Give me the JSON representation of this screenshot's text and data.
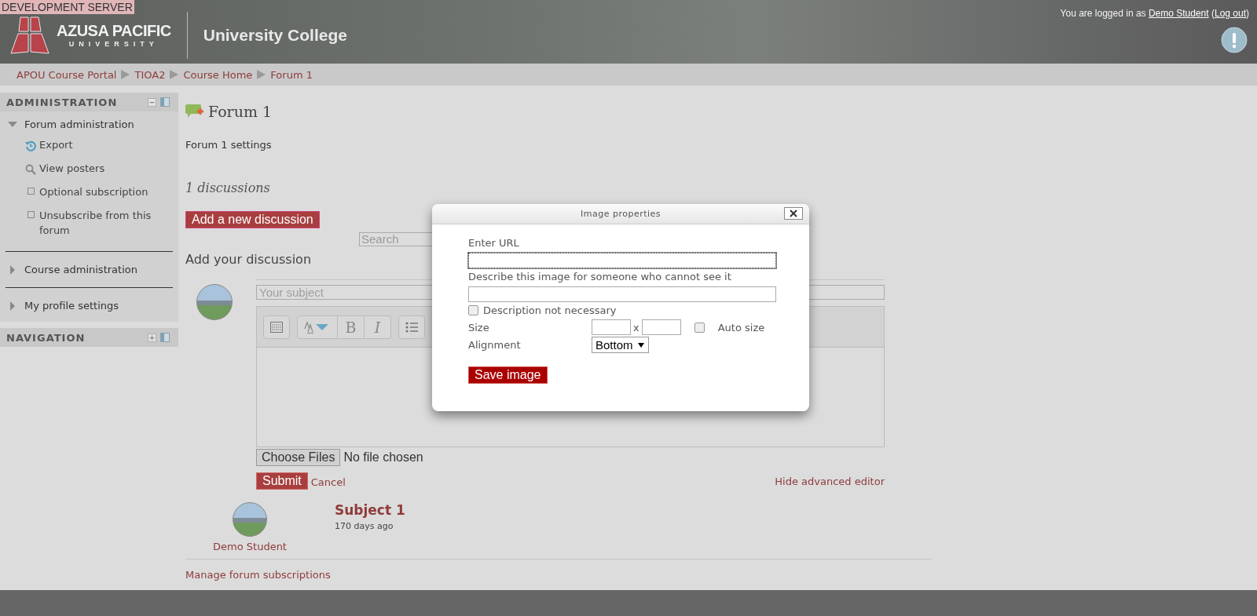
{
  "dev_banner": "DEVELOPMENT SERVER",
  "header": {
    "logo_name": "AZUSA PACIFIC",
    "logo_sub": "UNIVERSITY",
    "site_title": "University College",
    "login_text": "You are logged in as",
    "user": "Demo Student",
    "logout_before": "(",
    "logout": "Log out",
    "logout_after": ")"
  },
  "breadcrumb": [
    "APOU Course Portal",
    "TIOA2",
    "Course Home",
    "Forum 1"
  ],
  "sidebar": [
    {
      "title": "ADMINISTRATION",
      "expanded": true,
      "items": [
        {
          "label": "Forum administration",
          "expanded": true,
          "children": [
            {
              "label": "Export",
              "kind": "history"
            },
            {
              "label": "View posters",
              "kind": "search"
            },
            {
              "label": "Optional subscription",
              "kind": "bullet"
            },
            {
              "label": "Unsubscribe from this forum",
              "kind": "bullet"
            }
          ]
        },
        {
          "label": "Course administration",
          "expanded": false
        },
        {
          "label": "My profile settings",
          "expanded": false
        }
      ]
    },
    {
      "title": "NAVIGATION",
      "expanded": false
    }
  ],
  "main": {
    "title": "Forum 1",
    "settings_link": "Forum 1 settings",
    "count": "1 discussions",
    "add_button": "Add a new discussion",
    "search_placeholder": "Search",
    "section_heading": "Add your discussion",
    "subject_placeholder": "Your subject",
    "toolbar": [
      {
        "kind": "toggle"
      },
      {
        "kind": "font"
      },
      {
        "kind": "bold",
        "label": "B"
      },
      {
        "kind": "italic",
        "label": "I"
      },
      {
        "kind": "list"
      }
    ],
    "choose_files": "Choose Files",
    "no_file": "No file chosen",
    "submit": "Submit",
    "cancel": "Cancel",
    "hide_editor": "Hide advanced editor",
    "discussions": [
      {
        "author": "Demo Student",
        "subject": "Subject 1",
        "time": "170 days ago"
      }
    ],
    "manage_link": "Manage forum subscriptions"
  },
  "dialog": {
    "title": "Image properties",
    "url_label": "Enter URL",
    "url_focused": true,
    "alt_label": "Describe this image for someone who cannot see it",
    "alt_none_label": "Description not necessary",
    "alt_none_checked": false,
    "size_label": "Size",
    "size_x": "x",
    "auto_size_label": "Auto size",
    "auto_size_checked": false,
    "alignment_label": "Alignment",
    "alignment": "Bottom",
    "save": "Save image"
  }
}
